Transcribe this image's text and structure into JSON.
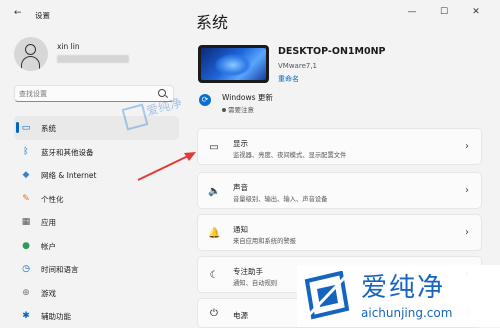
{
  "window": {
    "app_title": "设置",
    "back_glyph": "←",
    "controls": [
      "—",
      "☐",
      "✕"
    ]
  },
  "user": {
    "name": "xin lin"
  },
  "search": {
    "placeholder": "查找设置"
  },
  "sidebar": {
    "items": [
      {
        "label": "系统",
        "icon": "monitor-icon",
        "glyph": "▭",
        "color": "#0067c0",
        "selected": true
      },
      {
        "label": "蓝牙和其他设备",
        "icon": "bluetooth-icon",
        "glyph": "ᛒ",
        "color": "#0067c0"
      },
      {
        "label": "网络 & Internet",
        "icon": "wifi-icon",
        "glyph": "◆",
        "color": "#3b82c4"
      },
      {
        "label": "个性化",
        "icon": "brush-icon",
        "glyph": "✎",
        "color": "#c97b2c"
      },
      {
        "label": "应用",
        "icon": "apps-icon",
        "glyph": "▦",
        "color": "#555555"
      },
      {
        "label": "帐户",
        "icon": "account-icon",
        "glyph": "●",
        "color": "#2e9b5a"
      },
      {
        "label": "时间和语言",
        "icon": "globe-clock-icon",
        "glyph": "◷",
        "color": "#0067c0"
      },
      {
        "label": "游戏",
        "icon": "gamepad-icon",
        "glyph": "⊕",
        "color": "#777777"
      },
      {
        "label": "辅助功能",
        "icon": "accessibility-icon",
        "glyph": "✱",
        "color": "#0067c0"
      }
    ]
  },
  "main": {
    "title": "系统",
    "device": {
      "name": "DESKTOP-ON1M0NP",
      "model": "VMware7,1",
      "rename_label": "重命名"
    },
    "windows_update": {
      "title": "Windows 更新",
      "status": "需要注意"
    },
    "cards": [
      {
        "title": "显示",
        "subtitle": "监视器、亮度、夜间模式、显示配置文件",
        "icon": "display-icon",
        "glyph": "▭"
      },
      {
        "title": "声音",
        "subtitle": "音量级别、输出、输入、声音设备",
        "icon": "speaker-icon",
        "glyph": "🔈"
      },
      {
        "title": "通知",
        "subtitle": "来自应用和系统的警报",
        "icon": "bell-icon",
        "glyph": "🔔"
      },
      {
        "title": "专注助手",
        "subtitle": "通知、自动规则",
        "icon": "moon-icon",
        "glyph": "☾"
      },
      {
        "title": "电源",
        "subtitle": "",
        "icon": "power-icon",
        "glyph": "⏻"
      }
    ]
  },
  "watermark": {
    "brand_cn": "爱纯净",
    "url": "aichunjing.com"
  },
  "colors": {
    "accent": "#0067c0",
    "window_bg": "#f3f3f3",
    "card_bg": "#fbfbfb",
    "arrow": "#e53935"
  }
}
